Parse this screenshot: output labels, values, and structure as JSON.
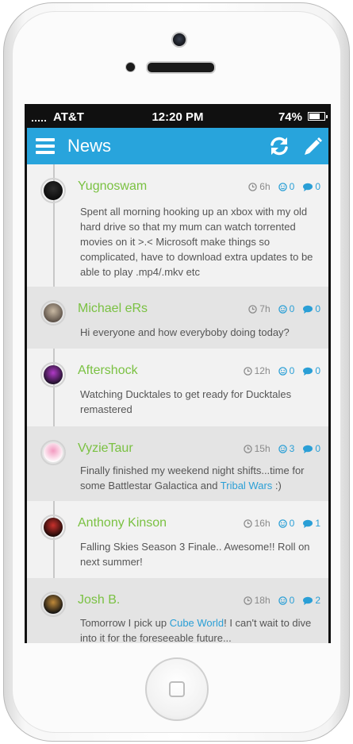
{
  "status_bar": {
    "carrier": "AT&T",
    "time": "12:20 PM",
    "battery": "74%",
    "battery_level": 0.74
  },
  "header": {
    "title": "News"
  },
  "posts": [
    {
      "user": "Yugnoswam",
      "age": "6h",
      "likes": "0",
      "comments": "0",
      "body_parts": [
        "Spent all morning hooking up an xbox with my old hard drive so that my mum can watch torrented movies on it >.< Microsoft make things so complicated, have to download extra updates to be able to play .mp4/.mkv etc"
      ]
    },
    {
      "user": "Michael eRs",
      "age": "7h",
      "likes": "0",
      "comments": "0",
      "body_parts": [
        "Hi everyone and how everyboby doing today?"
      ]
    },
    {
      "user": "Aftershock",
      "age": "12h",
      "likes": "0",
      "comments": "0",
      "body_parts": [
        "Watching Ducktales to get ready for Ducktales remastered"
      ]
    },
    {
      "user": "VyzieTaur",
      "age": "15h",
      "likes": "3",
      "comments": "0",
      "body_parts": [
        "Finally finished my weekend night shifts...time for some Battlestar Galactica and ",
        "Tribal Wars",
        " :)"
      ]
    },
    {
      "user": "Anthony Kinson",
      "age": "16h",
      "likes": "0",
      "comments": "1",
      "body_parts": [
        "Falling Skies Season 3 Finale.. Awesome!! Roll on next summer!"
      ]
    },
    {
      "user": "Josh B.",
      "age": "18h",
      "likes": "0",
      "comments": "2",
      "body_parts": [
        "Tomorrow I pick up ",
        "Cube World",
        "! I can't wait to dive into it for the foreseeable future..."
      ]
    }
  ],
  "colors": {
    "accent": "#28a4dc",
    "username": "#7ac142",
    "link": "#2a9fd6"
  },
  "icons": {
    "menu": "menu-icon",
    "refresh": "refresh-icon",
    "compose": "pencil-icon",
    "time": "clock-icon",
    "likes": "smiley-icon",
    "comments": "speech-bubble-icon"
  }
}
